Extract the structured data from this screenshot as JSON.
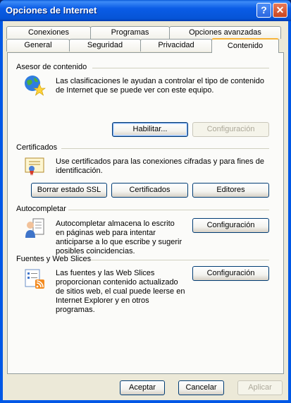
{
  "window": {
    "title": "Opciones de Internet",
    "help_label": "?",
    "close_label": "✕"
  },
  "tabs_back": [
    "Conexiones",
    "Programas",
    "Opciones avanzadas"
  ],
  "tabs_front": [
    "General",
    "Seguridad",
    "Privacidad",
    "Contenido"
  ],
  "content_advisor": {
    "heading": "Asesor de contenido",
    "text": "Las clasificaciones le ayudan a controlar el tipo de contenido de Internet que se puede ver con este equipo.",
    "enable_label": "Habilitar...",
    "settings_label": "Configuración",
    "icon": "globe-star-icon"
  },
  "certificates": {
    "heading": "Certificados",
    "text": "Use certificados para las conexiones cifradas y para fines de identificación.",
    "clear_ssl_label": "Borrar estado SSL",
    "certificates_label": "Certificados",
    "publishers_label": "Editores",
    "icon": "certificate-icon"
  },
  "autocomplete": {
    "heading": "Autocompletar",
    "text": "Autocompletar almacena lo escrito en páginas web para intentar anticiparse a lo que escribe y sugerir posibles coincidencias.",
    "settings_label": "Configuración",
    "icon": "autocomplete-person-icon"
  },
  "feeds": {
    "heading": "Fuentes y Web Slices",
    "text": "Las fuentes y las Web Slices proporcionan contenido actualizado de sitios web, el cual puede leerse en Internet Explorer y en otros programas.",
    "settings_label": "Configuración",
    "icon": "feed-rss-icon"
  },
  "footer": {
    "ok_label": "Aceptar",
    "cancel_label": "Cancelar",
    "apply_label": "Aplicar"
  }
}
